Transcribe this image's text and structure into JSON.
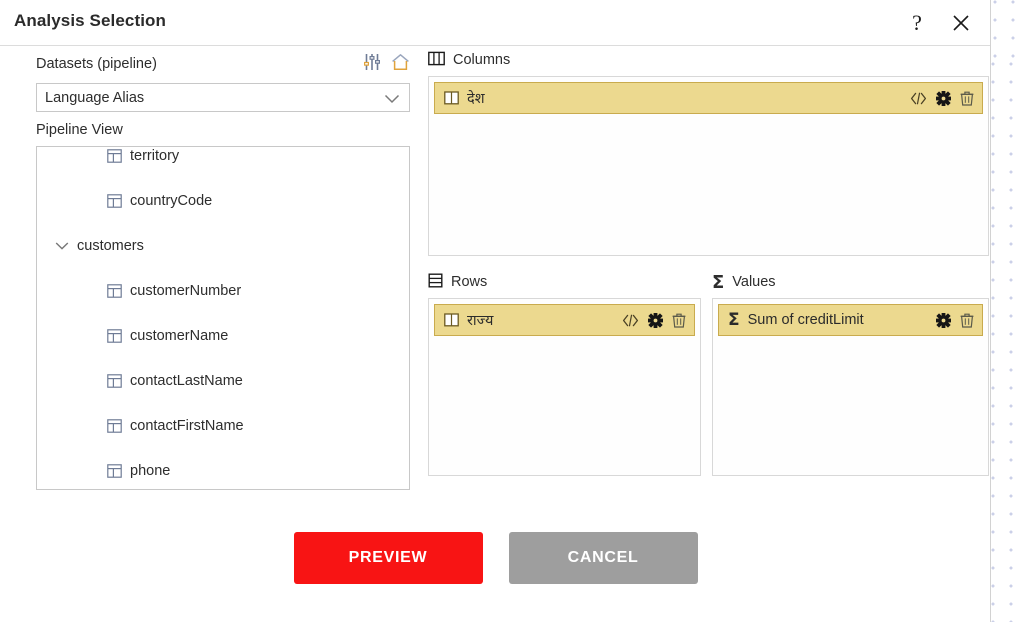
{
  "window": {
    "title": "Analysis Selection",
    "help_icon": "question-mark-icon",
    "close_icon": "close-icon"
  },
  "left_pane": {
    "datasets_label": "Datasets (pipeline)",
    "settings_icon": "sliders-icon",
    "home_icon": "home-icon",
    "dataset_select": {
      "value": "Language Alias",
      "chevron_icon": "chevron-down-icon"
    },
    "pipeline_view_label": "Pipeline View",
    "tree": [
      {
        "label": "territory",
        "type": "field",
        "icon": "table-field-icon"
      },
      {
        "label": "countryCode",
        "type": "field",
        "icon": "table-field-icon"
      },
      {
        "label": "customers",
        "type": "table",
        "icon": "chevron-down-icon",
        "expanded": true
      },
      {
        "label": "customerNumber",
        "type": "field",
        "icon": "table-field-icon"
      },
      {
        "label": "customerName",
        "type": "field",
        "icon": "table-field-icon"
      },
      {
        "label": "contactLastName",
        "type": "field",
        "icon": "table-field-icon"
      },
      {
        "label": "contactFirstName",
        "type": "field",
        "icon": "table-field-icon"
      },
      {
        "label": "phone",
        "type": "field",
        "icon": "table-field-icon"
      }
    ]
  },
  "zones": {
    "columns": {
      "label": "Columns",
      "icon": "columns-icon",
      "chips": [
        {
          "label": "देश",
          "icon": "columns-field-icon",
          "actions": [
            "code-icon",
            "gear-icon",
            "trash-icon"
          ]
        }
      ]
    },
    "rows": {
      "label": "Rows",
      "icon": "rows-icon",
      "chips": [
        {
          "label": "राज्य",
          "icon": "columns-field-icon",
          "actions": [
            "code-icon",
            "gear-icon",
            "trash-icon"
          ]
        }
      ]
    },
    "values": {
      "label": "Values",
      "icon": "sigma-icon",
      "chips": [
        {
          "label": "Sum of creditLimit",
          "icon": "sigma-icon",
          "actions": [
            "gear-icon",
            "trash-icon"
          ]
        }
      ]
    }
  },
  "footer": {
    "preview_label": "PREVIEW",
    "cancel_label": "CANCEL"
  },
  "colors": {
    "preview_button": "#f81414",
    "cancel_button": "#9e9e9e",
    "chip_background": "#ecd98f",
    "chip_border": "#c9ab4e",
    "dot_pattern": "#b9c0e0"
  }
}
